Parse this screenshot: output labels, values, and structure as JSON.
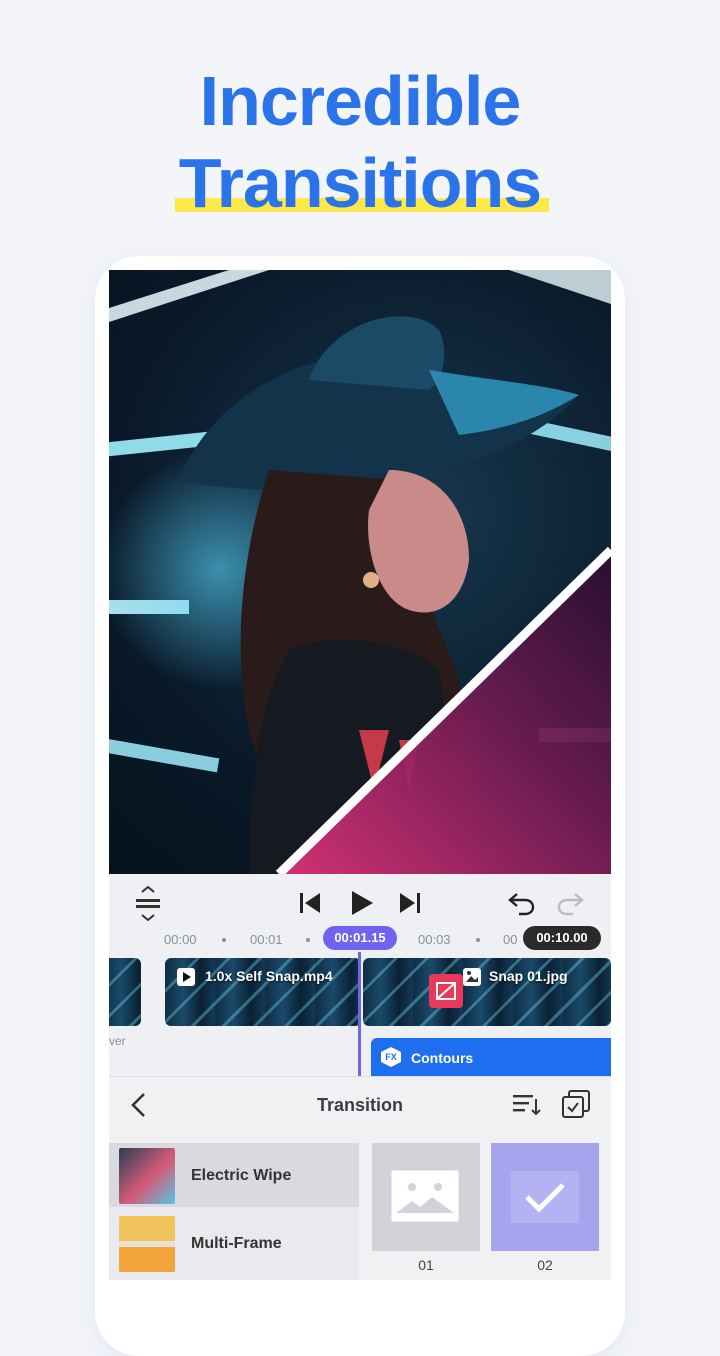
{
  "headline": {
    "line1": "Incredible",
    "line2": "Transitions"
  },
  "colors": {
    "accent": "#2b73e8",
    "highlight": "#ffe84a",
    "playhead": "#6f63f0",
    "fx_track": "#1f6ef0",
    "transition_chip": "#e8395a"
  },
  "controls": {
    "icons": [
      "split-icon",
      "skip-back-icon",
      "play-icon",
      "skip-forward-icon",
      "undo-icon",
      "redo-icon"
    ]
  },
  "ruler": {
    "ticks": [
      "00:00",
      "00:01",
      "00:03",
      "00"
    ],
    "current_time": "00:01.15",
    "total_time": "00:10.00"
  },
  "timeline": {
    "clip1_label": "1.0x Self Snap.mp4",
    "clip2_label": "Snap 01.jpg",
    "left_label": "ver",
    "fx_label": "Contours",
    "fx_badge": "FX"
  },
  "panel": {
    "title": "Transition",
    "list": [
      {
        "label": "Electric Wipe"
      },
      {
        "label": "Multi-Frame"
      }
    ],
    "grid": [
      {
        "caption": "01"
      },
      {
        "caption": "02"
      }
    ]
  }
}
